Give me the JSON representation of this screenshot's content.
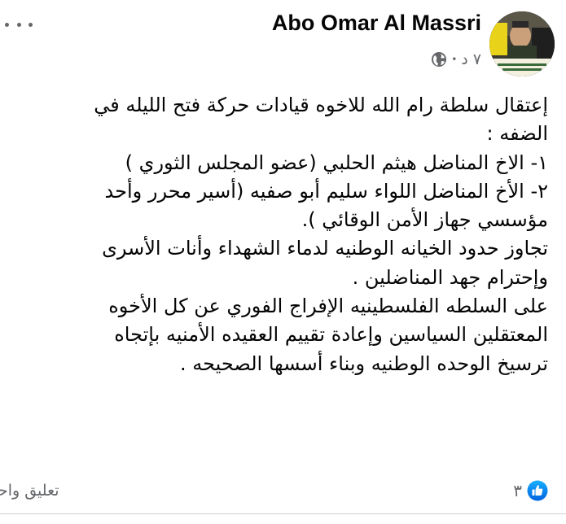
{
  "post": {
    "author": "Abo Omar Al Massri",
    "time": "٧ د",
    "separator": "•",
    "privacy_icon": "globe-icon",
    "more_icon": "more-horizontal-icon",
    "body_lines": [
      "إعتقال سلطة رام الله للاخوه قيادات حركة فتح الليله في",
      "الضفه :",
      "١- الاخ المناضل هيثم الحلبي (عضو المجلس الثوري )",
      "٢- الأخ المناضل اللواء سليم أبو صفيه (أسير محرر وأحد",
      "مؤسسي جهاز الأمن الوقائي ).",
      "تجاوز حدود الخيانه الوطنيه لدماء الشهداء وأنات الأسرى",
      "وإحترام جهد المناضلين .",
      "على السلطه الفلسطينيه الإفراج الفوري عن كل الأخوه",
      "المعتقلين السياسين وإعادة تقييم العقيده الأمنيه بإتجاه",
      "ترسيخ الوحده الوطنيه وبناء أسسها الصحيحه ."
    ]
  },
  "footer": {
    "reactions_count": "٣",
    "reaction_icon": "like-icon",
    "comments_label": "تعليق واحد"
  },
  "colors": {
    "text": "#050505",
    "secondary": "#65676b",
    "like_blue": "#1877f2",
    "divider": "#ced0d4"
  }
}
